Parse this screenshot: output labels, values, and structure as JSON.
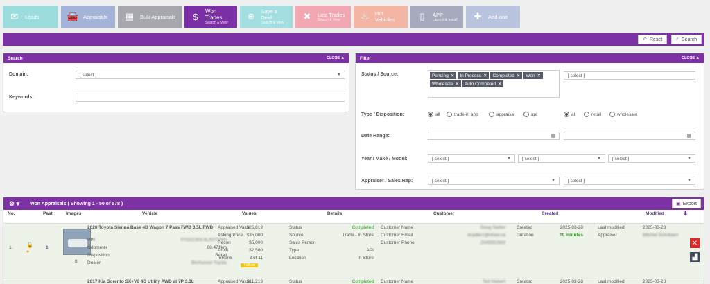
{
  "nav": [
    {
      "label": "Leads",
      "sub": "",
      "icon": "mail-icon"
    },
    {
      "label": "Appraisals",
      "sub": "",
      "icon": "car-icon"
    },
    {
      "label": "Bulk Appraisals",
      "sub": "",
      "icon": "calculator-icon"
    },
    {
      "label": "Won Trades",
      "sub": "Search & View",
      "icon": "money-icon"
    },
    {
      "label": "Save a Deal",
      "sub": "Search & View",
      "icon": "lifebuoy-icon"
    },
    {
      "label": "Lost Trades",
      "sub": "Search & View",
      "icon": "x-icon"
    },
    {
      "label": "Hot Vehicles",
      "sub": "",
      "icon": "fire-icon"
    },
    {
      "label": "APP",
      "sub": "Launch & Install",
      "icon": "phone-icon"
    },
    {
      "label": "Add-ons",
      "sub": "",
      "icon": "puzzle-icon"
    }
  ],
  "actions": {
    "reset": "Reset",
    "search": "Search"
  },
  "search_panel": {
    "title": "Search",
    "close": "CLOSE ▲",
    "domain_label": "Domain:",
    "domain_value": "[ select ]",
    "keywords_label": "Keywords:"
  },
  "filter_panel": {
    "title": "Filter",
    "close": "CLOSE ▲",
    "status_label": "Status / Source:",
    "status_tags": [
      "Pending",
      "In Process",
      "Completed",
      "Won",
      "Wholesale",
      "Auto Competed"
    ],
    "source_value": "[ select ]",
    "type_label": "Type / Disposition:",
    "type_options": [
      "all",
      "trade-in app",
      "appraisal",
      "api"
    ],
    "disp_options": [
      "all",
      "retail",
      "wholesale"
    ],
    "date_label": "Date Range:",
    "ymm_label": "Year / Make / Model:",
    "year_value": "[ select ]",
    "make_value": "[ select ]",
    "model_value": "[ select ]",
    "rep_label": "Appraiser / Sales Rep:",
    "appraiser_value": "[ select ]",
    "rep_value": "[ select ]"
  },
  "results": {
    "title": "Won Appraisals ( Showing 1 - 50 of 578 )",
    "export": "Export",
    "columns": [
      "No.",
      "Past",
      "Images",
      "Vehicle",
      "Values",
      "Details",
      "Customer",
      "Created",
      "Modified"
    ],
    "rows": [
      {
        "no": "1.",
        "past": "1",
        "images": "8",
        "vehicle": "2020 Toyota Sienna Base 4D Wagon 7 Pass FWD 3.5L FWD",
        "vin_label": "VIN",
        "vin": "5TDZZ3DC4LS073765",
        "odometer_label": "Odometer",
        "odometer": "68,471km",
        "disposition_label": "Disposition",
        "disposition": "Retail",
        "dealer_label": "Dealer",
        "dealer": "Birchwood Toyota",
        "appraised_label": "Appraised Value",
        "appraised": "$26,819",
        "asking_label": "Asking Price",
        "asking": "$35,000",
        "recon_label": "Recon",
        "recon": "$5,000",
        "profit_label": "Profit",
        "profit": "$2,500",
        "mrank_label": "mRank",
        "mrank": "8 of 11",
        "badge": "Yellow",
        "status_label": "Status",
        "status": "Completed",
        "source_label": "Source",
        "source": "Trade - In Store",
        "salesperson_label": "Sales Person",
        "type_label": "Type",
        "type": "API",
        "location_label": "Location",
        "location": "In-Store",
        "cust_name_label": "Customer Name",
        "cust_name": "Doug Sadler",
        "cust_email_label": "Customer Email",
        "cust_email": "dsadler1@shaw.ca",
        "cust_phone_label": "Customer Phone",
        "cust_phone": "2045552684",
        "created_label": "Created",
        "created": "2025-03-28",
        "duration_label": "Duration",
        "duration": "19 minutes",
        "modified_label": "Last modified",
        "modified": "2025-03-28",
        "appraiser_label": "Appraiser",
        "appraiser": "Mitchel Schollaert"
      },
      {
        "vehicle": "2017 Kia Sorento SX+V6 4D Utility AWD at 7P 3.3L",
        "appraised_label": "Appraised Value",
        "appraised": "$11,219",
        "status_label": "Status",
        "status": "Completed",
        "cust_name_label": "Customer Name",
        "cust_name": "Ted Hiebert",
        "created_label": "Created",
        "created": "2025-03-28",
        "modified_label": "Last modified",
        "modified": "2025-03-28"
      }
    ]
  },
  "colors": {
    "purple": "#7c31a4",
    "green": "#3a9c2f",
    "badge": "#f5c518",
    "delete": "#e02727",
    "chart": "#3e4a5c"
  }
}
